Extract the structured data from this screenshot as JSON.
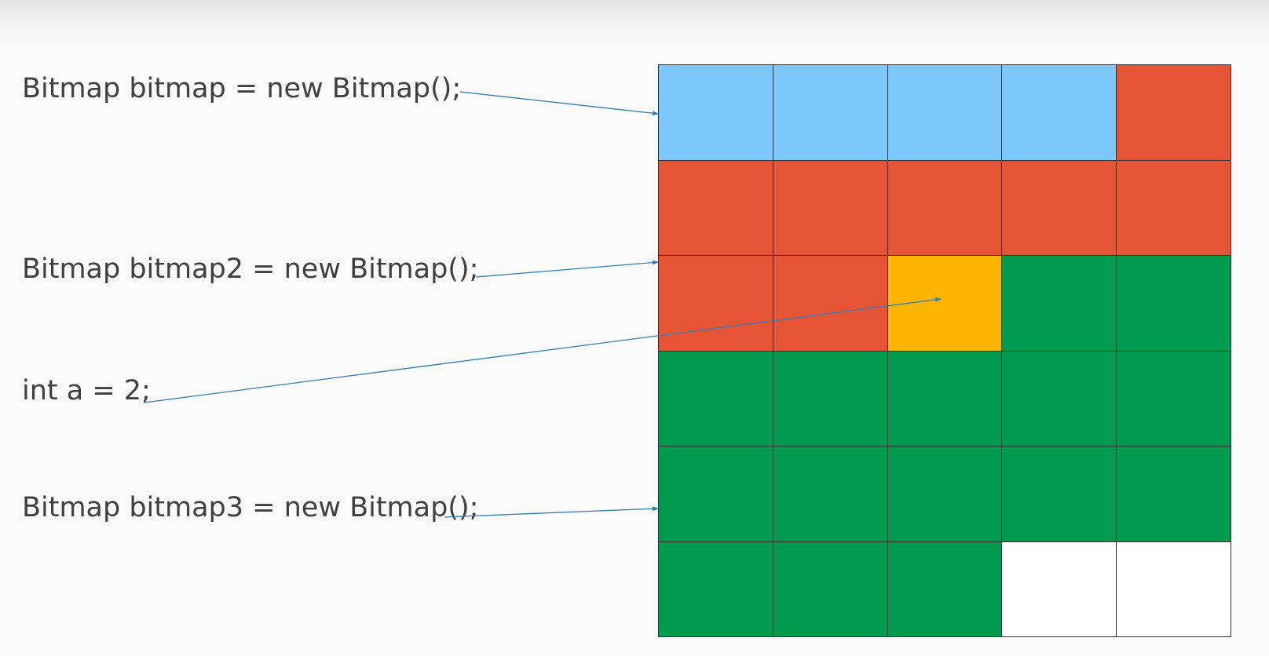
{
  "labels": [
    "Bitmap bitmap = new Bitmap();",
    "Bitmap bitmap2 = new Bitmap();",
    "int a = 2;",
    "Bitmap bitmap3 = new Bitmap();"
  ],
  "colors": {
    "blue": "#7cc8fd",
    "red": "#e65436",
    "yellow": "#feb500",
    "green": "#019a4e",
    "white": "#ffffff",
    "arrow": "#2e7fb8"
  },
  "grid": {
    "columns": 5,
    "rows": 6,
    "cells": [
      [
        "blue",
        "blue",
        "blue",
        "blue",
        "red"
      ],
      [
        "red",
        "red",
        "red",
        "red",
        "red"
      ],
      [
        "red",
        "red",
        "yellow",
        "green",
        "green"
      ],
      [
        "green",
        "green",
        "green",
        "green",
        "green"
      ],
      [
        "green",
        "green",
        "green",
        "green",
        "green"
      ],
      [
        "green",
        "green",
        "green",
        "white",
        "white"
      ]
    ]
  }
}
